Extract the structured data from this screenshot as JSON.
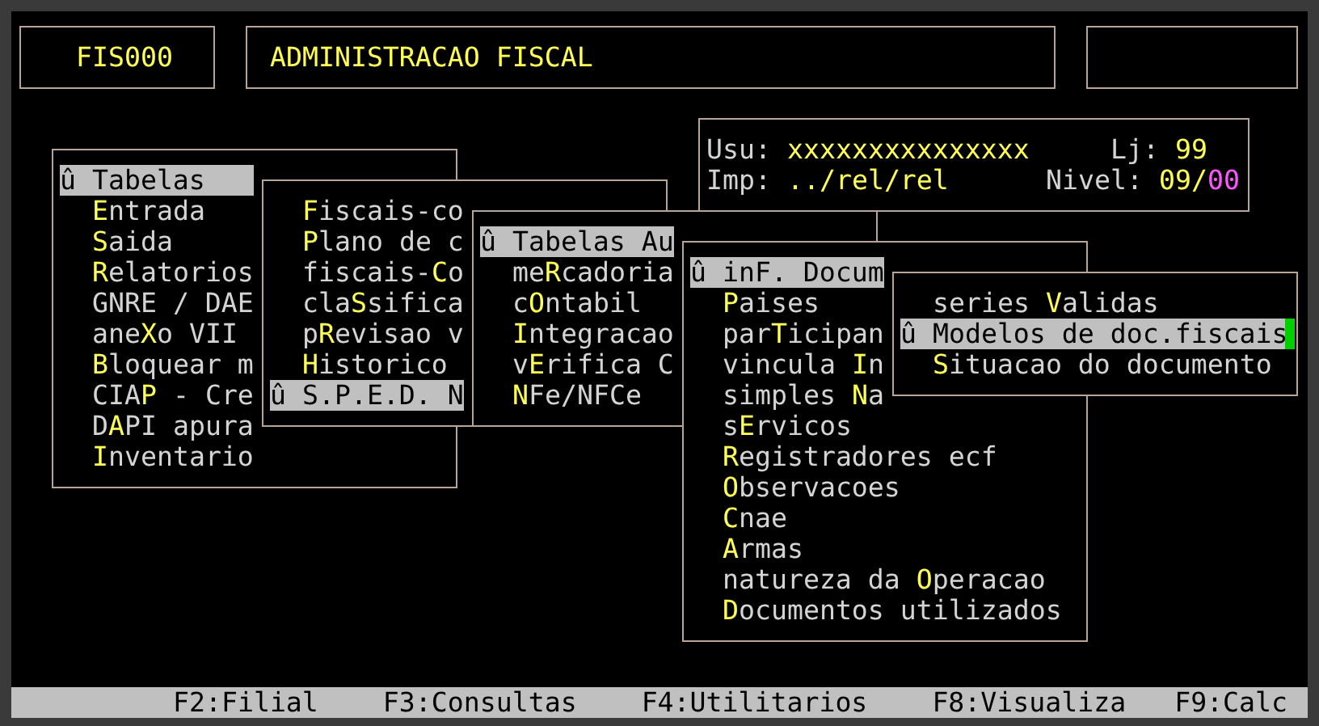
{
  "header": {
    "code": "FIS000",
    "title": "ADMINISTRACAO FISCAL"
  },
  "info": {
    "user_label": "Usu:",
    "user": "xxxxxxxxxxxxxxx",
    "store_label": "Lj:",
    "store": "99",
    "printer_label": "Imp:",
    "printer": "../rel/rel",
    "nivel_label": "Nivel:",
    "nivel_value": "09/**00**"
  },
  "menus": [
    {
      "items": [
        {
          "label": "û Tabelas",
          "selected": true
        },
        {
          "label": "**E**ntrada",
          "selected": false
        },
        {
          "label": "**S**aida",
          "selected": false
        },
        {
          "label": "**R**elatorios",
          "selected": false
        },
        {
          "label": "GNRE / DAE",
          "selected": false
        },
        {
          "label": "ane**X**o VII",
          "selected": false
        },
        {
          "label": "**B**loquear m",
          "selected": false
        },
        {
          "label": "CIA**P** - Cre",
          "selected": false
        },
        {
          "label": "D**A**PI apura",
          "selected": false
        },
        {
          "label": "**I**nventario",
          "selected": false
        }
      ]
    },
    {
      "items": [
        {
          "label": "**F**iscais-co",
          "selected": false
        },
        {
          "label": "**P**lano de c",
          "selected": false
        },
        {
          "label": "fiscais-**C**o",
          "selected": false
        },
        {
          "label": "cla**S**sifica",
          "selected": false
        },
        {
          "label": "p**R**evisao v",
          "selected": false
        },
        {
          "label": "**H**istorico",
          "selected": false
        },
        {
          "label": "û S.P.E.D. N",
          "selected": true
        }
      ]
    },
    {
      "items": [
        {
          "label": "û Tabelas Au",
          "selected": true
        },
        {
          "label": "me**R**cadoria",
          "selected": false
        },
        {
          "label": "c**O**ntabil",
          "selected": false
        },
        {
          "label": "**I**ntegracao",
          "selected": false
        },
        {
          "label": "v**E**rifica C",
          "selected": false
        },
        {
          "label": "**N**Fe/NFCe",
          "selected": false
        }
      ]
    },
    {
      "items": [
        {
          "label": "û inF. Docum",
          "selected": true
        },
        {
          "label": "**P**aises",
          "selected": false
        },
        {
          "label": "par**T**icipan",
          "selected": false
        },
        {
          "label": "vincula **I**n",
          "selected": false
        },
        {
          "label": "simples **N**a",
          "selected": false
        },
        {
          "label": "s**E**rvicos",
          "selected": false
        },
        {
          "label": "**R**egistradores ecf",
          "selected": false
        },
        {
          "label": "**O**bservacoes",
          "selected": false
        },
        {
          "label": "**C**nae",
          "selected": false
        },
        {
          "label": "**A**rmas",
          "selected": false
        },
        {
          "label": "natureza da **O**peracao",
          "selected": false
        },
        {
          "label": "**D**ocumentos utilizados",
          "selected": false
        }
      ]
    },
    {
      "items": [
        {
          "label": "series **V**alidas",
          "selected": false
        },
        {
          "label": "û Modelos de doc.fiscais",
          "selected": true
        },
        {
          "label": "**S**ituacao do documento",
          "selected": false
        }
      ]
    }
  ],
  "status_bar": [
    {
      "label": "F2:Filial"
    },
    {
      "label": "F3:Consultas"
    },
    {
      "label": "F4:Utilitarios"
    },
    {
      "label": "F8:Visualiza"
    },
    {
      "label": "F9:Calc"
    }
  ]
}
